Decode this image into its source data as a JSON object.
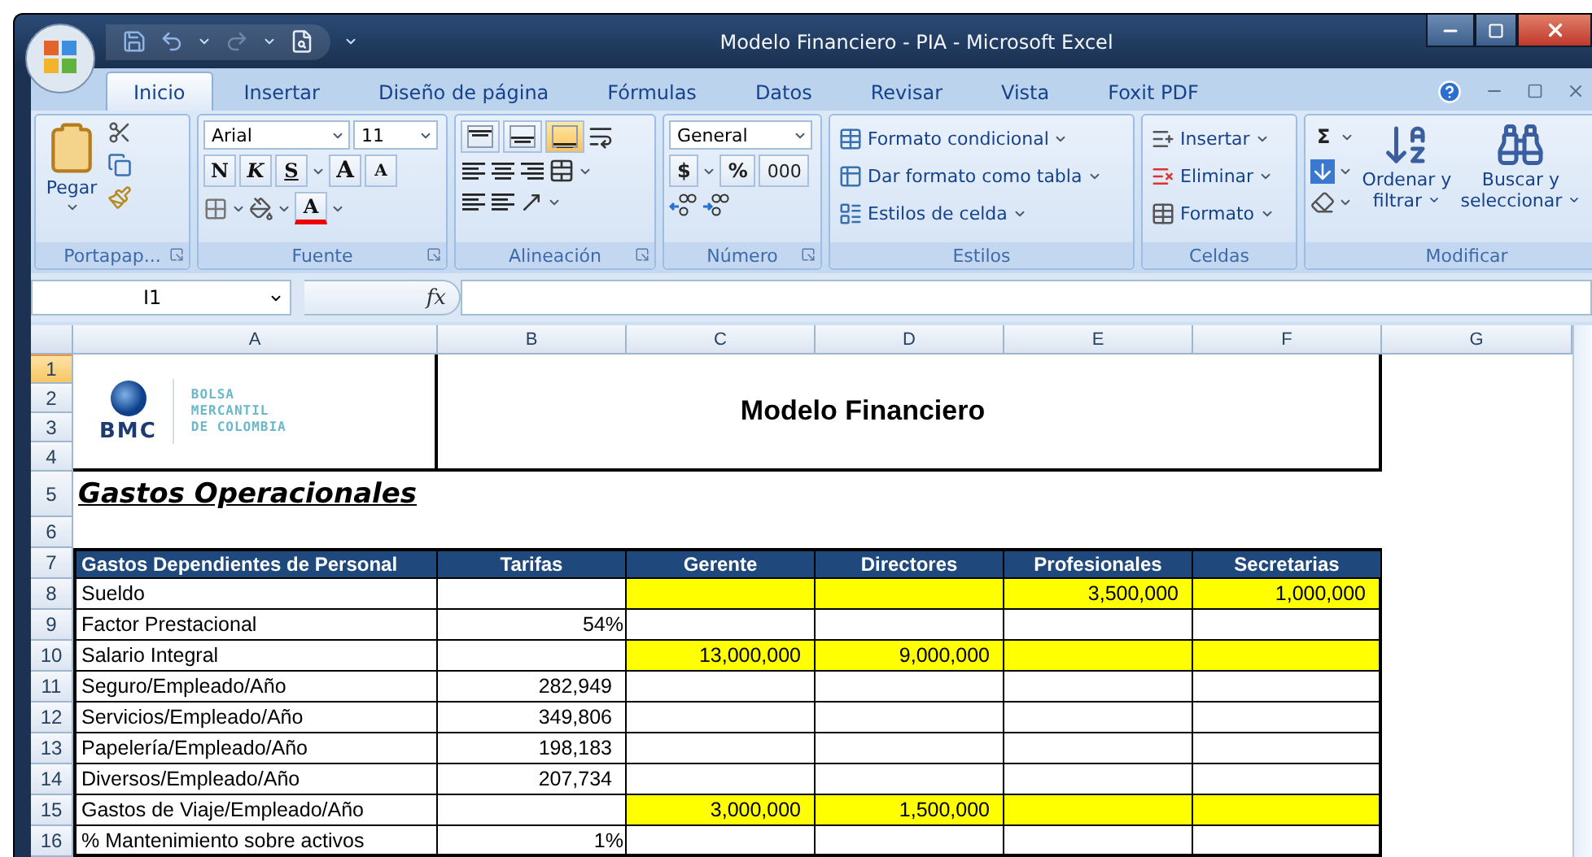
{
  "window": {
    "title": "Modelo Financiero - PIA - Microsoft Excel"
  },
  "tabs": [
    {
      "label": "Inicio",
      "selected": true
    },
    {
      "label": "Insertar",
      "selected": false
    },
    {
      "label": "Diseño de página",
      "selected": false
    },
    {
      "label": "Fórmulas",
      "selected": false
    },
    {
      "label": "Datos",
      "selected": false
    },
    {
      "label": "Revisar",
      "selected": false
    },
    {
      "label": "Vista",
      "selected": false
    },
    {
      "label": "Foxit PDF",
      "selected": false
    }
  ],
  "ribbon": {
    "clipboard": {
      "label": "Portapap...",
      "paste": "Pegar"
    },
    "font": {
      "label": "Fuente",
      "font_name": "Arial",
      "font_size": "11",
      "bold": "N",
      "italic": "K",
      "underline": "S",
      "grow": "A",
      "shrink": "A",
      "font_color": "A"
    },
    "alignment": {
      "label": "Alineación",
      "vertical": [
        {
          "kind": "top",
          "selected": false
        },
        {
          "kind": "middle",
          "selected": false
        },
        {
          "kind": "bottom",
          "selected": true
        }
      ]
    },
    "number": {
      "label": "Número",
      "format": "General",
      "currency": "$",
      "percent": "%",
      "thousands": "000"
    },
    "styles": {
      "label": "Estilos",
      "items": [
        {
          "kind": "conditional",
          "label": "Formato condicional"
        },
        {
          "kind": "table",
          "label": "Dar formato como tabla"
        },
        {
          "kind": "cellstyle",
          "label": "Estilos de celda"
        }
      ]
    },
    "cells": {
      "label": "Celdas",
      "items": [
        {
          "kind": "insert",
          "label": "Insertar"
        },
        {
          "kind": "delete",
          "label": "Eliminar"
        },
        {
          "kind": "format",
          "label": "Formato"
        }
      ]
    },
    "editing": {
      "label": "Modificar",
      "sum": "Σ",
      "sort": "Ordenar y filtrar",
      "find": "Buscar y seleccionar"
    }
  },
  "formula_bar": {
    "name_box": "I1",
    "function": "fx"
  },
  "sheet": {
    "columns": [
      "A",
      "B",
      "C",
      "D",
      "E",
      "F",
      "G"
    ],
    "rows": [
      {
        "label": "1",
        "selected": true
      },
      {
        "label": "2",
        "selected": false
      },
      {
        "label": "3",
        "selected": false
      },
      {
        "label": "4",
        "selected": false
      },
      {
        "label": "5",
        "selected": false
      },
      {
        "label": "6",
        "selected": false
      },
      {
        "label": "7",
        "selected": false
      },
      {
        "label": "8",
        "selected": false
      },
      {
        "label": "9",
        "selected": false
      },
      {
        "label": "10",
        "selected": false
      },
      {
        "label": "11",
        "selected": false
      },
      {
        "label": "12",
        "selected": false
      },
      {
        "label": "13",
        "selected": false
      },
      {
        "label": "14",
        "selected": false
      },
      {
        "label": "15",
        "selected": false
      },
      {
        "label": "16",
        "selected": false
      }
    ],
    "logo": {
      "mark": "BMC",
      "tagline": [
        "BOLSA",
        "MERCANTIL",
        "DE COLOMBIA"
      ]
    },
    "title": "Modelo Financiero",
    "section": "Gastos Operacionales",
    "table": {
      "header": [
        "Gastos Dependientes de Personal",
        "Tarifas",
        "Gerente",
        "Directores",
        "Profesionales",
        "Secretarias"
      ],
      "rows": [
        {
          "label": "Sueldo",
          "cells": [
            {
              "highlighted": false
            },
            {
              "highlighted": true
            },
            {
              "highlighted": true
            },
            {
              "value": "3,500,000",
              "highlighted": true
            },
            {
              "value": "1,000,000",
              "highlighted": true
            }
          ]
        },
        {
          "label": "Factor Prestacional",
          "cells": [
            {
              "value": "54%",
              "highlighted": false
            },
            {
              "highlighted": false
            },
            {
              "highlighted": false
            },
            {
              "highlighted": false
            },
            {
              "highlighted": false
            }
          ]
        },
        {
          "label": "Salario Integral",
          "cells": [
            {
              "highlighted": false
            },
            {
              "value": "13,000,000",
              "highlighted": true
            },
            {
              "value": "9,000,000",
              "highlighted": true
            },
            {
              "highlighted": true
            },
            {
              "highlighted": true
            }
          ]
        },
        {
          "label": "Seguro/Empleado/Año",
          "cells": [
            {
              "value": "282,949",
              "highlighted": false
            },
            {
              "highlighted": false
            },
            {
              "highlighted": false
            },
            {
              "highlighted": false
            },
            {
              "highlighted": false
            }
          ]
        },
        {
          "label": "Servicios/Empleado/Año",
          "cells": [
            {
              "value": "349,806",
              "highlighted": false
            },
            {
              "highlighted": false
            },
            {
              "highlighted": false
            },
            {
              "highlighted": false
            },
            {
              "highlighted": false
            }
          ]
        },
        {
          "label": "Papelería/Empleado/Año",
          "cells": [
            {
              "value": "198,183",
              "highlighted": false
            },
            {
              "highlighted": false
            },
            {
              "highlighted": false
            },
            {
              "highlighted": false
            },
            {
              "highlighted": false
            }
          ]
        },
        {
          "label": "Diversos/Empleado/Año",
          "cells": [
            {
              "value": "207,734",
              "highlighted": false
            },
            {
              "highlighted": false
            },
            {
              "highlighted": false
            },
            {
              "highlighted": false
            },
            {
              "highlighted": false
            }
          ]
        },
        {
          "label": "Gastos de Viaje/Empleado/Año",
          "cells": [
            {
              "highlighted": false
            },
            {
              "value": "3,000,000",
              "highlighted": true
            },
            {
              "value": "1,500,000",
              "highlighted": true
            },
            {
              "highlighted": true
            },
            {
              "highlighted": true
            }
          ]
        },
        {
          "label": "% Mantenimiento sobre activos",
          "cells": [
            {
              "value": "1%",
              "highlighted": false
            },
            {
              "highlighted": false
            },
            {
              "highlighted": false
            },
            {
              "highlighted": false
            },
            {
              "highlighted": false
            }
          ]
        }
      ]
    }
  }
}
